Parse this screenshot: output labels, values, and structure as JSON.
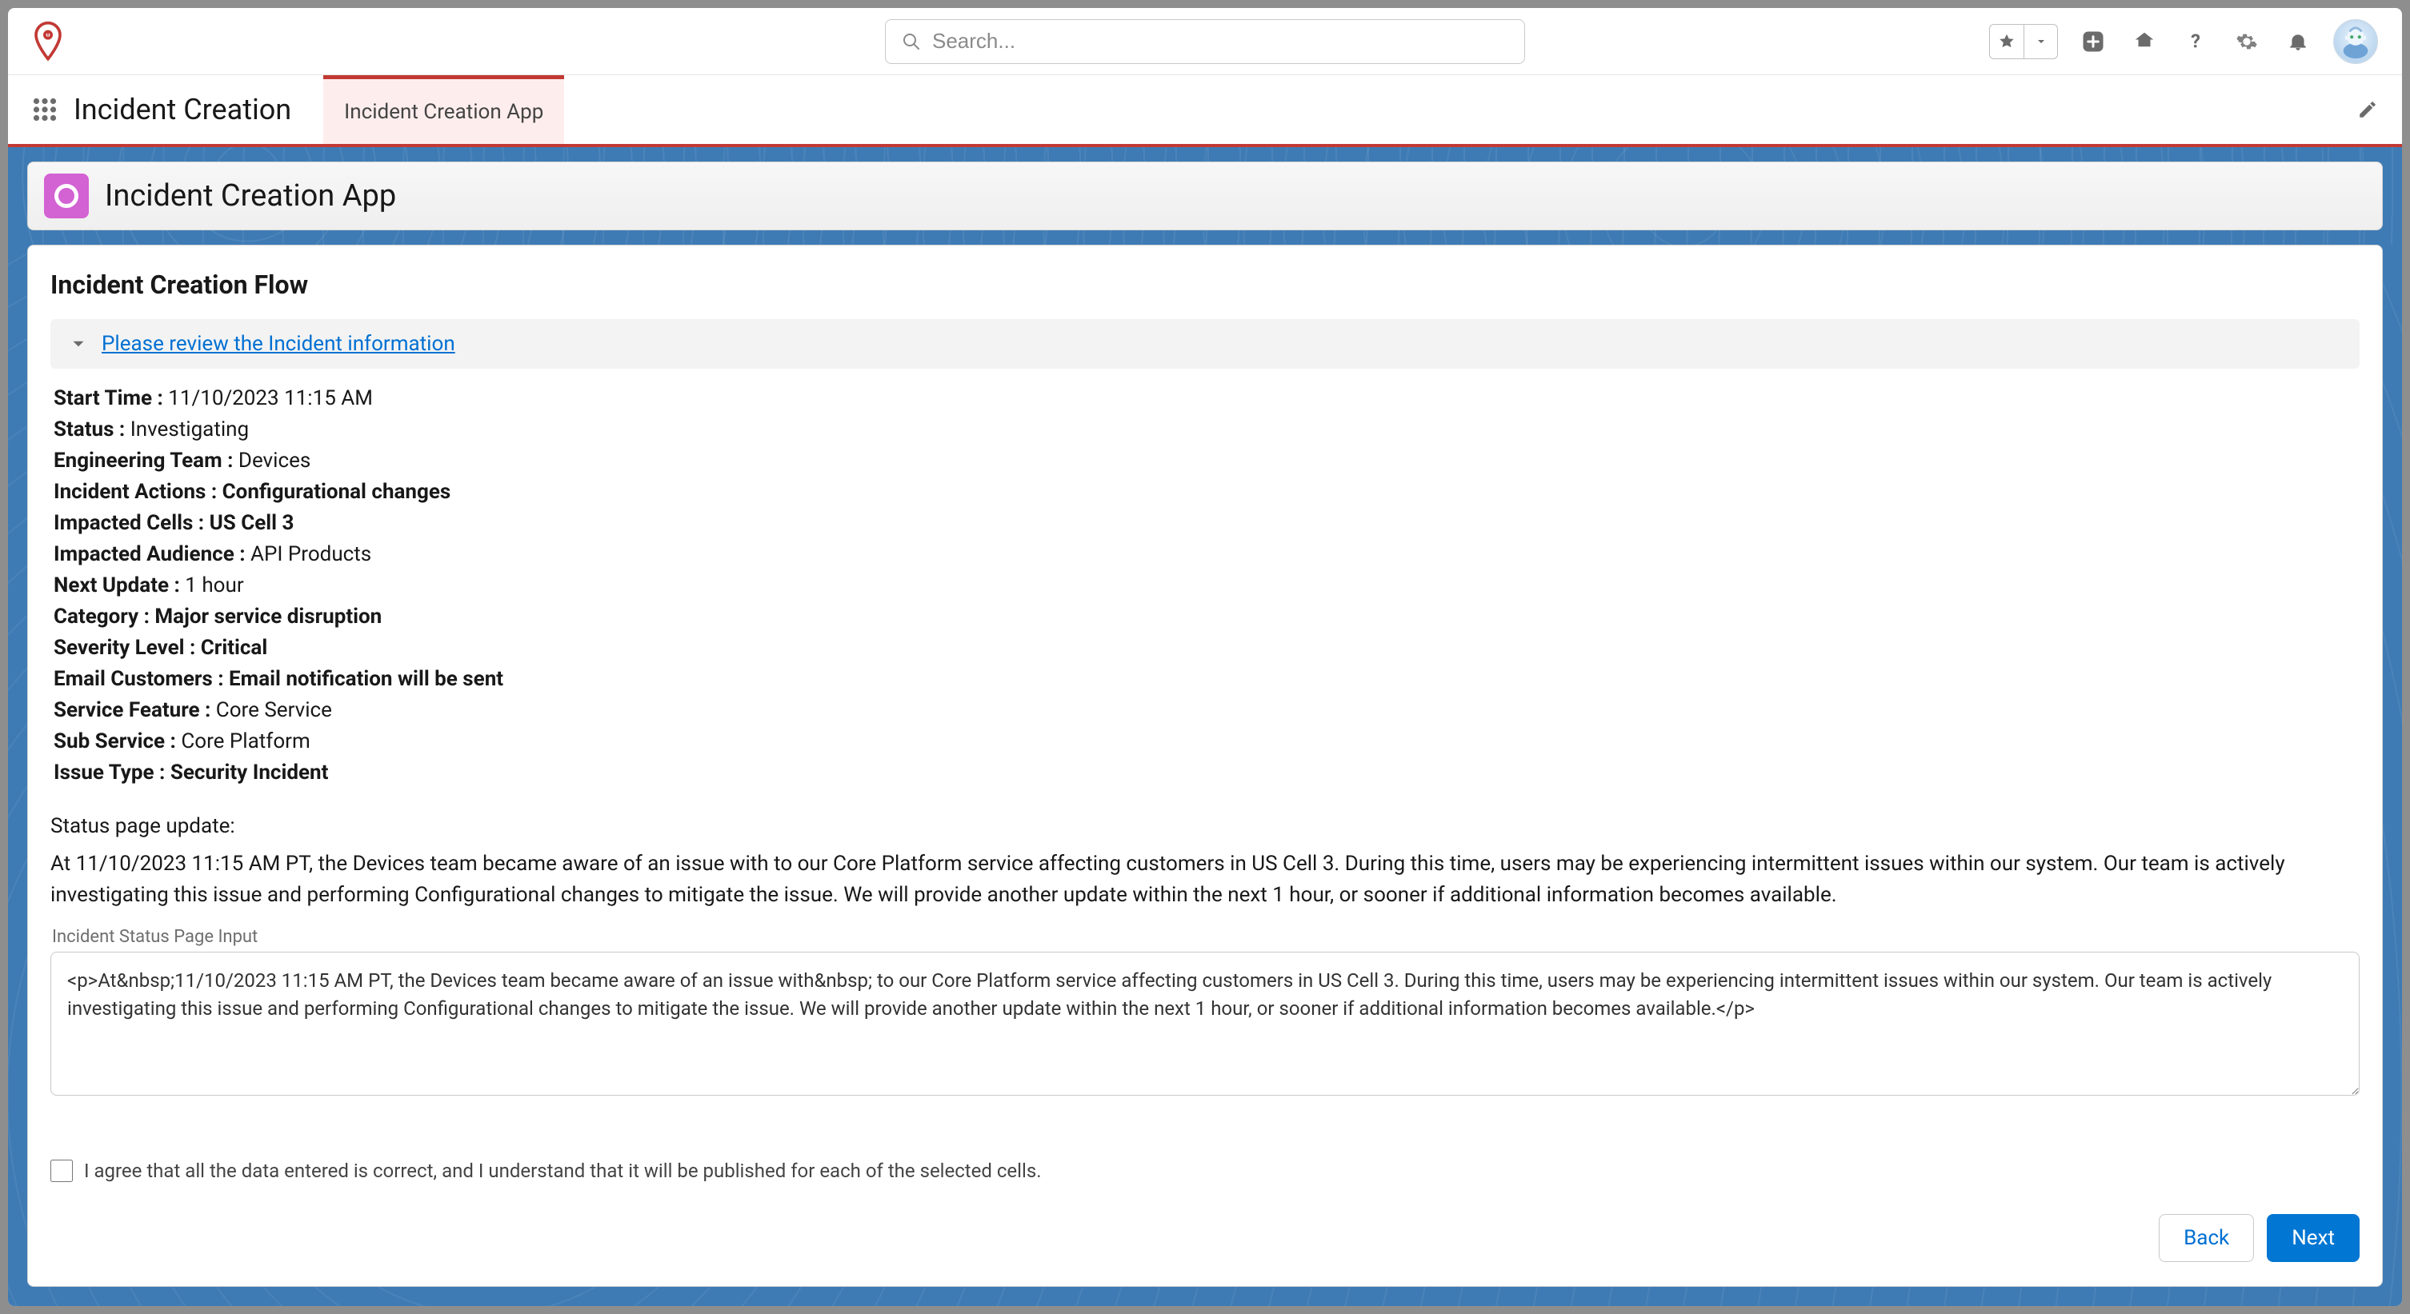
{
  "header": {
    "search_placeholder": "Search...",
    "app_name": "Incident Creation",
    "tab_label": "Incident Creation App"
  },
  "page_header": {
    "title": "Incident Creation App"
  },
  "flow": {
    "title": "Incident Creation Flow",
    "section_header": "Please review the Incident information",
    "fields": {
      "start_time": {
        "label": "Start Time : ",
        "value": "11/10/2023 11:15 AM",
        "bold_value": false
      },
      "status": {
        "label": "Status : ",
        "value": "Investigating",
        "bold_value": false
      },
      "eng_team": {
        "label": "Engineering Team : ",
        "value": "Devices",
        "bold_value": false
      },
      "incident_actions": {
        "label": "Incident Actions : ",
        "value": "Configurational changes",
        "bold_value": true
      },
      "impacted_cells": {
        "label": "Impacted Cells : ",
        "value": "US Cell 3",
        "bold_value": true
      },
      "impacted_aud": {
        "label": "Impacted Audience : ",
        "value": "API Products",
        "bold_value": false
      },
      "next_update": {
        "label": "Next Update : ",
        "value": "1 hour",
        "bold_value": false
      },
      "category": {
        "label": "Category : ",
        "value": "Major service disruption",
        "bold_value": true
      },
      "severity": {
        "label": "Severity Level : ",
        "value": "Critical",
        "bold_value": true
      },
      "email_cust": {
        "label": "Email Customers : ",
        "value": "Email notification will be sent",
        "bold_value": true
      },
      "service_feature": {
        "label": "Service Feature : ",
        "value": "Core Service",
        "bold_value": false
      },
      "sub_service": {
        "label": "Sub Service : ",
        "value": "Core Platform",
        "bold_value": false
      },
      "issue_type": {
        "label": "Issue Type : ",
        "value": "Security Incident",
        "bold_value": true
      }
    },
    "status_page_label": "Status page update:",
    "status_page_text": "At 11/10/2023 11:15 AM PT, the Devices team became aware of an issue with  to our Core Platform service affecting customers in US Cell 3. During this time, users may be experiencing intermittent issues within our system. Our team is actively investigating this issue and performing Configurational changes to mitigate the issue. We will provide another update within the next 1 hour, or sooner if additional information becomes available.",
    "textarea_label": "Incident Status Page Input",
    "textarea_value": "<p>At&nbsp;11/10/2023 11:15 AM PT, the Devices team became aware of an issue with&nbsp; to our Core Platform service affecting customers in US Cell 3. During this time, users may be experiencing intermittent issues within our system. Our team is actively investigating this issue and performing Configurational changes to mitigate the issue. We will provide another update within the next 1 hour, or sooner if additional information becomes available.</p>",
    "agree_text": "I agree that all the data entered is correct, and I understand that it will be published for each of the selected cells.",
    "back_label": "Back",
    "next_label": "Next"
  }
}
